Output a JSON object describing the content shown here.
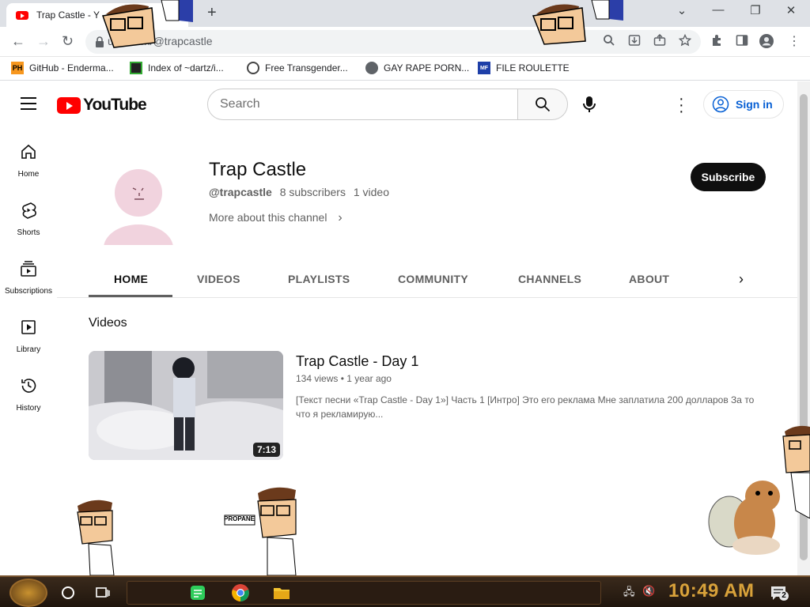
{
  "browser": {
    "tab_title": "Trap Castle - Y",
    "new_tab": "+",
    "url": "youtube.com/@trapcastle",
    "url_visible": "ube.com/@trapcastle",
    "window_controls": {
      "dropdown": "⌄",
      "minimize": "—",
      "restore": "❐",
      "close": "✕"
    },
    "bookmarks": [
      {
        "label": "GitHub - Enderma...",
        "icon": "ph-icon",
        "icon_text": "PH"
      },
      {
        "label": "Index of ~dartz/i...",
        "icon": "qr-icon",
        "icon_text": ""
      },
      {
        "label": "Free Transgender...",
        "icon": "mask-icon",
        "icon_text": ""
      },
      {
        "label": "GAY RAPE PORN...",
        "icon": "globe-icon",
        "icon_text": ""
      },
      {
        "label": "FILE ROULETTE",
        "icon": "roulette-icon",
        "icon_text": "MF"
      }
    ]
  },
  "youtube": {
    "logo_text": "YouTube",
    "search_placeholder": "Search",
    "sign_in": "Sign in",
    "sidebar": [
      {
        "label": "Home",
        "icon": "home-icon"
      },
      {
        "label": "Shorts",
        "icon": "shorts-icon"
      },
      {
        "label": "Subscriptions",
        "icon": "subscriptions-icon"
      },
      {
        "label": "Library",
        "icon": "library-icon"
      },
      {
        "label": "History",
        "icon": "history-icon"
      }
    ],
    "channel": {
      "name": "Trap Castle",
      "handle": "@trapcastle",
      "subscribers": "8 subscribers",
      "videos": "1 video",
      "more": "More about this channel",
      "subscribe": "Subscribe"
    },
    "tabs": [
      "HOME",
      "VIDEOS",
      "PLAYLISTS",
      "COMMUNITY",
      "CHANNELS",
      "ABOUT"
    ],
    "section_title": "Videos",
    "video": {
      "title": "Trap Castle - Day 1",
      "views": "134 views",
      "age": "1 year ago",
      "duration": "7:13",
      "description": "[Текст песни «Trap Castle - Day 1»] Часть 1 [Интро] Это его реклама Мне заплатила 200 долларов За то что я рекламирую..."
    }
  },
  "overlay": {
    "propane_sign": "PROPANE"
  },
  "taskbar": {
    "time": "10:49 AM",
    "notification_count": "2"
  },
  "colors": {
    "youtube_red": "#ff0000",
    "link_blue": "#065fd4",
    "clock_gold": "#d9a23a"
  }
}
